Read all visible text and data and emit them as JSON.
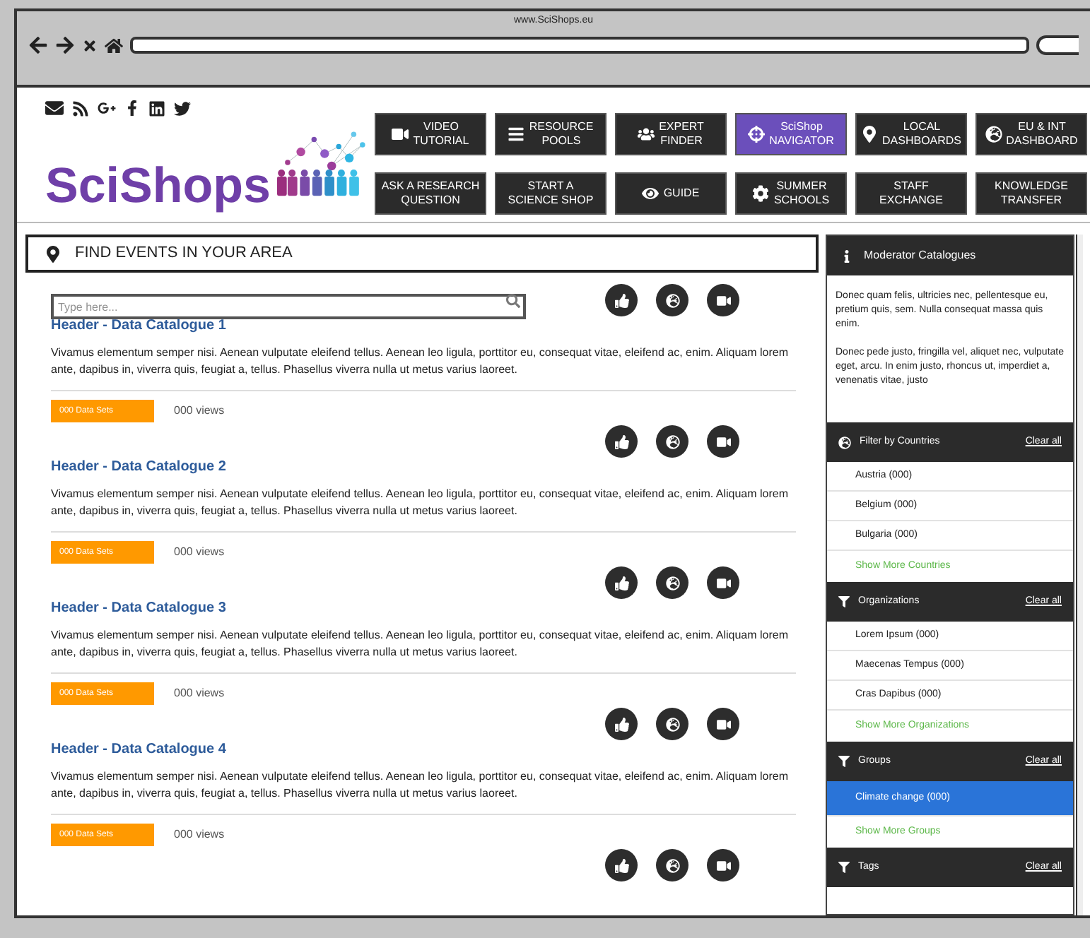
{
  "browser": {
    "url": "www.SciShops.eu"
  },
  "logo": {
    "text": "SciShops"
  },
  "nav": [
    {
      "label": "VIDEO\nTUTORIAL",
      "selected": false
    },
    {
      "label": "RESOURCE\nPOOLS",
      "selected": false
    },
    {
      "label": "EXPERT\nFINDER",
      "selected": false
    },
    {
      "label": "SciShop\nNAVIGATOR",
      "selected": true
    },
    {
      "label": "LOCAL\nDASHBOARDS",
      "selected": false
    },
    {
      "label": "EU & INT\nDASHBOARD",
      "selected": false
    },
    {
      "label": "ASK A RESEARCH\nQUESTION",
      "selected": false
    },
    {
      "label": "START A\nSCIENCE SHOP",
      "selected": false
    },
    {
      "label": "GUIDE",
      "selected": false
    },
    {
      "label": "SUMMER\nSCHOOLS",
      "selected": false
    },
    {
      "label": "STAFF\nEXCHANGE",
      "selected": false
    },
    {
      "label": "KNOWLEDGE\nTRANSFER",
      "selected": false
    }
  ],
  "events": {
    "title": "FIND EVENTS IN YOUR AREA",
    "placeholder": "Type here..."
  },
  "catalogues": [
    {
      "title": "Header - Data Catalogue 1",
      "description": "Vivamus elementum semper nisi. Aenean vulputate eleifend tellus. Aenean leo ligula, porttitor eu, consequat vitae, eleifend ac, enim. Aliquam lorem ante, dapibus in, viverra quis, feugiat a, tellus. Phasellus viverra nulla ut metus varius laoreet.",
      "datasets": "000 Data Sets",
      "views": "000 views"
    },
    {
      "title": "Header - Data Catalogue 2",
      "description": "Vivamus elementum semper nisi. Aenean vulputate eleifend tellus. Aenean leo ligula, porttitor eu, consequat vitae, eleifend ac, enim. Aliquam lorem ante, dapibus in, viverra quis, feugiat a, tellus. Phasellus viverra nulla ut metus varius laoreet.",
      "datasets": "000 Data Sets",
      "views": "000 views"
    },
    {
      "title": "Header - Data Catalogue 3",
      "description": "Vivamus elementum semper nisi. Aenean vulputate eleifend tellus. Aenean leo ligula, porttitor eu, consequat vitae, eleifend ac, enim. Aliquam lorem ante, dapibus in, viverra quis, feugiat a, tellus. Phasellus viverra nulla ut metus varius laoreet.",
      "datasets": "000 Data Sets",
      "views": "000 views"
    },
    {
      "title": "Header - Data Catalogue 4",
      "description": "Vivamus elementum semper nisi. Aenean vulputate eleifend tellus. Aenean leo ligula, porttitor eu, consequat vitae, eleifend ac, enim. Aliquam lorem ante, dapibus in, viverra quis, feugiat a, tellus. Phasellus viverra nulla ut metus varius laoreet.",
      "datasets": "000 Data Sets",
      "views": "000 views"
    }
  ],
  "sidebar": {
    "moderator": {
      "title": "Moderator Catalogues",
      "paragraphs": [
        "Donec quam felis, ultricies nec, pellentesque eu, pretium quis, sem. Nulla consequat massa quis enim.",
        "Donec pede justo, fringilla vel, aliquet nec, vulputate eget, arcu. In enim justo, rhoncus ut, imperdiet a, venenatis vitae, justo"
      ]
    },
    "filters": [
      {
        "title": "Filter by Countries",
        "clear": "Clear all",
        "items": [
          {
            "label": "Austria (000)",
            "selected": false
          },
          {
            "label": "Belgium (000)",
            "selected": false
          },
          {
            "label": "Bulgaria (000)",
            "selected": false
          }
        ],
        "more": "Show More Countries"
      },
      {
        "title": "Organizations",
        "clear": "Clear all",
        "items": [
          {
            "label": "Lorem Ipsum (000)",
            "selected": false
          },
          {
            "label": "Maecenas Tempus (000)",
            "selected": false
          },
          {
            "label": "Cras Dapibus (000)",
            "selected": false
          }
        ],
        "more": "Show More Organizations"
      },
      {
        "title": "Groups",
        "clear": "Clear all",
        "items": [
          {
            "label": "Climate change (000)",
            "selected": true
          }
        ],
        "more": "Show More Groups"
      },
      {
        "title": "Tags",
        "clear": "Clear all"
      }
    ]
  }
}
